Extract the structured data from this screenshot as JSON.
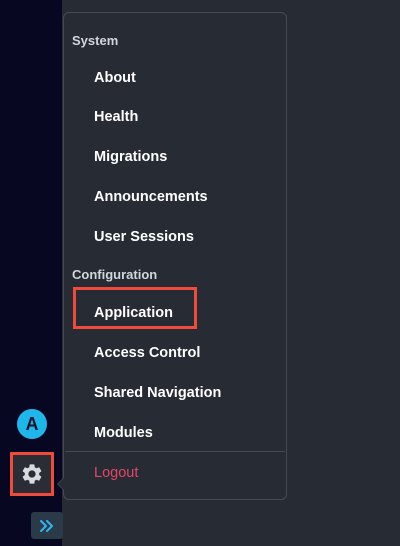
{
  "sidebar": {
    "avatar_initial": "A",
    "settings_icon": "gear-icon",
    "expand_icon": "double-chevron-right-icon"
  },
  "menu": {
    "system_heading": "System",
    "system_items": [
      "About",
      "Health",
      "Migrations",
      "Announcements",
      "User Sessions"
    ],
    "configuration_heading": "Configuration",
    "configuration_items": [
      "Application",
      "Access Control",
      "Shared Navigation",
      "Modules"
    ],
    "logout_label": "Logout"
  },
  "colors": {
    "rail_background": "#070722",
    "menu_background": "#272b33",
    "highlight_border": "#f04a3a",
    "avatar": "#1eb7ea",
    "expand_icon": "#2fb5f0",
    "logout_text": "#e0466a"
  }
}
